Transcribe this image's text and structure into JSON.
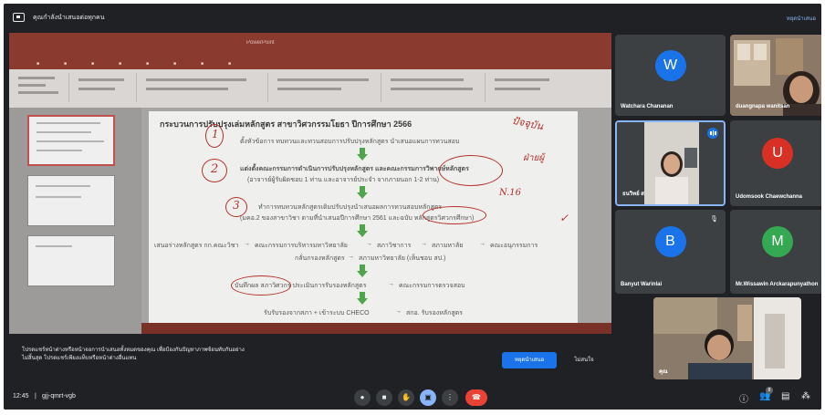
{
  "topbar": {
    "presenting_label": "คุณกำลังนำเสนอต่อทุกคน",
    "stop_label": "หยุดนำเสนอ"
  },
  "slide": {
    "title": "กระบวนการปรับปรุงเล่มหลักสูตร สาขาวิศวกรรมโยธา ปีการศึกษา 2566",
    "steps": [
      "ตั้งหัวข้อการ ทบทวนและทวนสอบการปรับปรุงหลักสูตร นำเสนอแผนการทวนสอบ",
      "แต่งตั้งคณะกรรมการดำเนินการปรับปรุงหลักสูตร และคณะกรรมการวิพากษ์หลักสูตร",
      "(อาจารย์ผู้รับผิดชอบ 1 ท่าน และอาจารย์ประจำ จากภายนอก 1-2 ท่าน)",
      "ทำการทบทวนหลักสูตรเดิมปรับปรุงนำเสนอผลการทวนสอบหลักสูตร",
      "(มคอ.2 ของสาขาวิชา ตามที่นำเสนอปีการศึกษา 2561 และฉบับ หลักสูตรวิศวกรศึกษา)",
      "เสนอร่างหลักสูตร กก.คณะวิชา",
      "คณะกรรมการบริหารมหาวิทยาลัย",
      "สภาวิชาการ",
      "สภามหาลัย",
      "คณะอนุกรรมการ",
      "กลั่นกรองหลักสูตร",
      "สภามหาวิทยาลัย (เห็นชอบ สป.)",
      "บันทึกผล สภาวิศวกร ประเมินการรับรองหลักสูตร",
      "คณะกรรมการตรวจสอบ",
      "รับรับรองจากสภา + เข้าระบบ CHECO",
      "สกอ. รับรองหลักสูตร"
    ],
    "annotations": [
      "1",
      "2",
      "3",
      "ปัจจุบัน",
      "ฝ่ายผู้",
      "N.16"
    ]
  },
  "caption": {
    "line1": "โปรดแชร์หน้าต่างหรือหน้าจอการนำเสนอทั้งหมดของคุณ เพื่อป้องกันปัญหาภาพซ้อนทับกันอย่าง",
    "line2": "ไม่สิ้นสุด โปรดแชร์เพียงแท็บหรือหน้าต่างอื่นแทน"
  },
  "infinity_prompt": {
    "stop_button": "หยุดนำเสนอ",
    "dismiss_button": "ไม่สนใจ"
  },
  "participants": [
    {
      "name": "Watchara Chananan",
      "initial": "W",
      "color": "#1a73e8"
    },
    {
      "name": "duangnapa wanitsan",
      "initial": "",
      "color": ""
    },
    {
      "name": "ธนวิทย์ ส",
      "initial": "",
      "color": ""
    },
    {
      "name": "Udomsook Chaewchanna",
      "initial": "U",
      "color": "#d93025"
    },
    {
      "name": "Banyut Warinlai",
      "initial": "B",
      "color": "#1a73e8"
    },
    {
      "name": "Mr.Wissawin Arckarapunyathon",
      "initial": "M",
      "color": "#34a853"
    },
    {
      "name": "คุณ",
      "initial": "",
      "color": ""
    }
  ],
  "bottombar": {
    "time": "12:45",
    "separator": "|",
    "meeting_code": "gjj-qmrt-vgb",
    "people_count": "8"
  }
}
